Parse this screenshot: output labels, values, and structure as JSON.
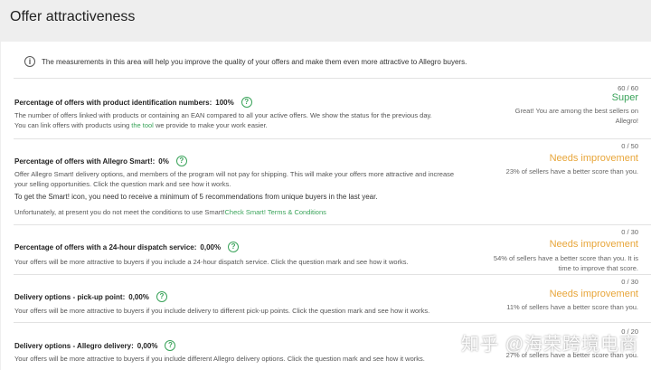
{
  "header": {
    "title": "Offer attractiveness"
  },
  "info": {
    "text": "The measurements in this area will help you improve the quality of your offers and make them even more attractive to Allegro buyers."
  },
  "sections": [
    {
      "title": "Percentage of offers with product identification numbers:",
      "value": "100%",
      "desc_line1": "The number of offers linked with products or containing an EAN compared to all your active offers. We show the status for the previous day.",
      "desc_line2_a": "You can link offers with products using ",
      "desc_line2_link": "the tool",
      "desc_line2_b": " we provide to make your work easier.",
      "score": "60 / 60",
      "status": "Super",
      "note_line1": "Great! You are among the best sellers on",
      "note_line2": "Allegro!"
    },
    {
      "title": "Percentage of offers with Allegro Smart!:",
      "value": "0%",
      "desc_line1": "Offer Allegro Smart! delivery options, and members of the program will not pay for shipping. This will make your offers more attractive and increase",
      "desc_line2": "your selling opportunities. Click the question mark and see how it works.",
      "desc_extra": "To get the Smart! icon, you need to receive a minimum of 5 recommendations from unique buyers in the last year.",
      "desc_unfortunately": "Unfortunately, at present you do not meet the conditions to use Smart!",
      "desc_link": "Check Smart! Terms & Conditions",
      "score": "0 / 50",
      "status": "Needs improvement",
      "note_line1": "23% of sellers have a better score than you."
    },
    {
      "title": "Percentage of offers with a 24-hour dispatch service:",
      "value": "0,00%",
      "desc_line1": "Your offers will be more attractive to buyers if you include a 24-hour dispatch service. Click the question mark and see how it works.",
      "score": "0 / 30",
      "status": "Needs improvement",
      "note_line1": "54% of sellers have a better score than you. It is",
      "note_line2": "time to improve that score."
    },
    {
      "title": "Delivery options - pick-up point:",
      "value": "0,00%",
      "desc_line1": "Your offers will be more attractive to buyers if you include delivery to different pick-up points. Click the question mark and see how it works.",
      "score": "0 / 30",
      "status": "Needs improvement",
      "note_line1": "11% of sellers have a better score than you."
    },
    {
      "title": "Delivery options - Allegro delivery:",
      "value": "0,00%",
      "desc_line1": "Your offers will be more attractive to buyers if you include different Allegro delivery options. Click the question mark and see how it works.",
      "score": "0 / 20",
      "note_line1": "27% of sellers have a better score than you."
    }
  ],
  "watermark": "知乎 @海荣跨境电商",
  "colors": {
    "super": "#3aa35a",
    "needs": "#e8a63a",
    "link": "#3aa35a"
  }
}
